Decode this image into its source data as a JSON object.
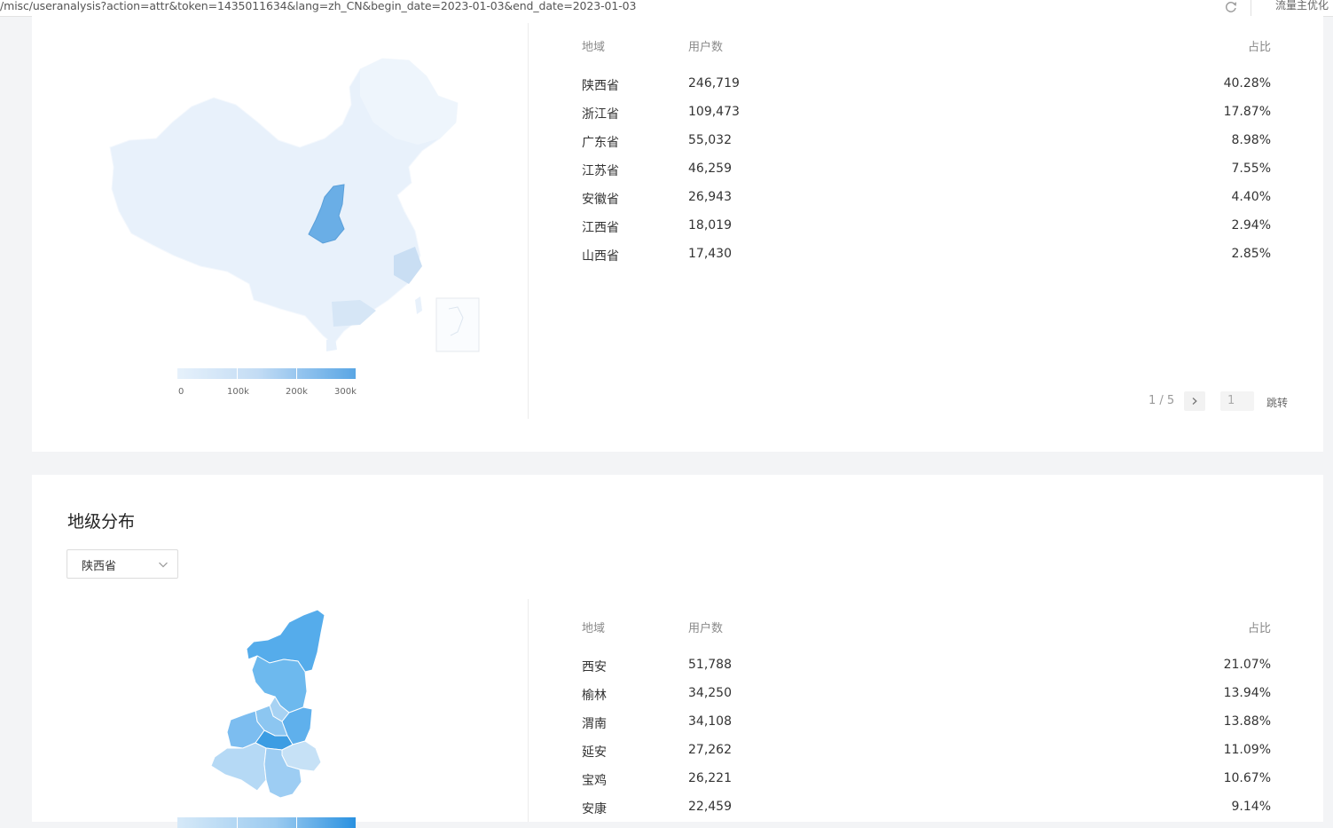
{
  "browser": {
    "url": "/misc/useranalysis?action=attr&token=1435011634&lang=zh_CN&begin_date=2023-01-03&end_date=2023-01-03",
    "ext_label": "流量主优化"
  },
  "province_section": {
    "columns": {
      "region": "地域",
      "users": "用户数",
      "share": "占比"
    },
    "rows": [
      {
        "region": "陕西省",
        "users": "246,719",
        "share": "40.28%"
      },
      {
        "region": "浙江省",
        "users": "109,473",
        "share": "17.87%"
      },
      {
        "region": "广东省",
        "users": "55,032",
        "share": "8.98%"
      },
      {
        "region": "江苏省",
        "users": "46,259",
        "share": "7.55%"
      },
      {
        "region": "安徽省",
        "users": "26,943",
        "share": "4.40%"
      },
      {
        "region": "江西省",
        "users": "18,019",
        "share": "2.94%"
      },
      {
        "region": "山西省",
        "users": "17,430",
        "share": "2.85%"
      }
    ],
    "legend": {
      "labels": [
        "0",
        "100k",
        "200k",
        "300k"
      ]
    },
    "pager": {
      "page": "1 / 5",
      "input_value": "1",
      "jump_label": "跳转"
    }
  },
  "city_section": {
    "title": "地级分布",
    "select_value": "陕西省",
    "columns": {
      "region": "地域",
      "users": "用户数",
      "share": "占比"
    },
    "rows": [
      {
        "region": "西安",
        "users": "51,788",
        "share": "21.07%"
      },
      {
        "region": "榆林",
        "users": "34,250",
        "share": "13.94%"
      },
      {
        "region": "渭南",
        "users": "34,108",
        "share": "13.88%"
      },
      {
        "region": "延安",
        "users": "27,262",
        "share": "11.09%"
      },
      {
        "region": "宝鸡",
        "users": "26,221",
        "share": "10.67%"
      },
      {
        "region": "安康",
        "users": "22,459",
        "share": "9.14%"
      }
    ]
  },
  "colors": {
    "map_base": "#e8f1fb",
    "map_highlight": "#6aaee6",
    "map_mid": "#c9def3",
    "shaanxi_strong": "#4fa9ea",
    "shaanxi_light": "#b9d9f4"
  }
}
